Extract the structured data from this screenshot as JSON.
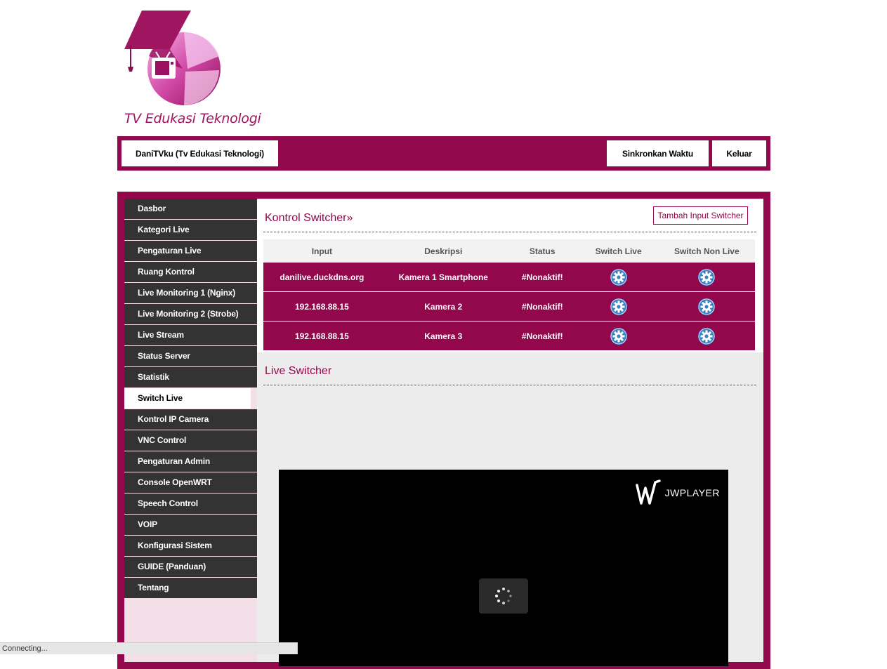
{
  "brand": {
    "name": "TV Edukasi Teknologi",
    "colors": {
      "primary": "#93074d",
      "sidebar": "#333333",
      "sidebar_bg": "#f2dfe8"
    }
  },
  "topbar": {
    "user_label": "DaniTVku (Tv Edukasi Teknologi)",
    "sync_label": "Sinkronkan Waktu",
    "logout_label": "Keluar"
  },
  "sidebar": {
    "items": [
      {
        "label": "Dasbor"
      },
      {
        "label": "Kategori Live"
      },
      {
        "label": "Pengaturan Live"
      },
      {
        "label": "Ruang Kontrol"
      },
      {
        "label": "Live Monitoring 1 (Nginx)"
      },
      {
        "label": "Live Monitoring 2 (Strobe)"
      },
      {
        "label": "Live Stream"
      },
      {
        "label": "Status Server"
      },
      {
        "label": "Statistik"
      },
      {
        "label": "Switch Live",
        "active": true
      },
      {
        "label": "Kontrol IP Camera"
      },
      {
        "label": "VNC Control"
      },
      {
        "label": "Pengaturan Admin"
      },
      {
        "label": "Console OpenWRT"
      },
      {
        "label": "Speech Control"
      },
      {
        "label": "VOIP"
      },
      {
        "label": "Konfigurasi Sistem"
      },
      {
        "label": "GUIDE (Panduan)"
      },
      {
        "label": "Tentang"
      }
    ]
  },
  "switcher": {
    "title": "Kontrol Switcher»",
    "add_button": "Tambah Input Switcher",
    "columns": [
      "Input",
      "Deskripsi",
      "Status",
      "Switch Live",
      "Switch Non Live"
    ],
    "rows": [
      {
        "input": "danilive.duckdns.org",
        "desc": "Kamera 1 Smartphone",
        "status": "#Nonaktif!",
        "live_icon": "gear-icon",
        "nonlive_icon": "gear-icon"
      },
      {
        "input": "192.168.88.15",
        "desc": "Kamera 2",
        "status": "#Nonaktif!",
        "live_icon": "gear-icon",
        "nonlive_icon": "gear-icon"
      },
      {
        "input": "192.168.88.15",
        "desc": "Kamera 3",
        "status": "#Nonaktif!",
        "live_icon": "gear-icon",
        "nonlive_icon": "gear-icon"
      }
    ]
  },
  "live": {
    "title": "Live Switcher",
    "player_brand": "JWPLAYER",
    "player_state": "loading"
  },
  "statusbar": {
    "text": "Connecting..."
  }
}
